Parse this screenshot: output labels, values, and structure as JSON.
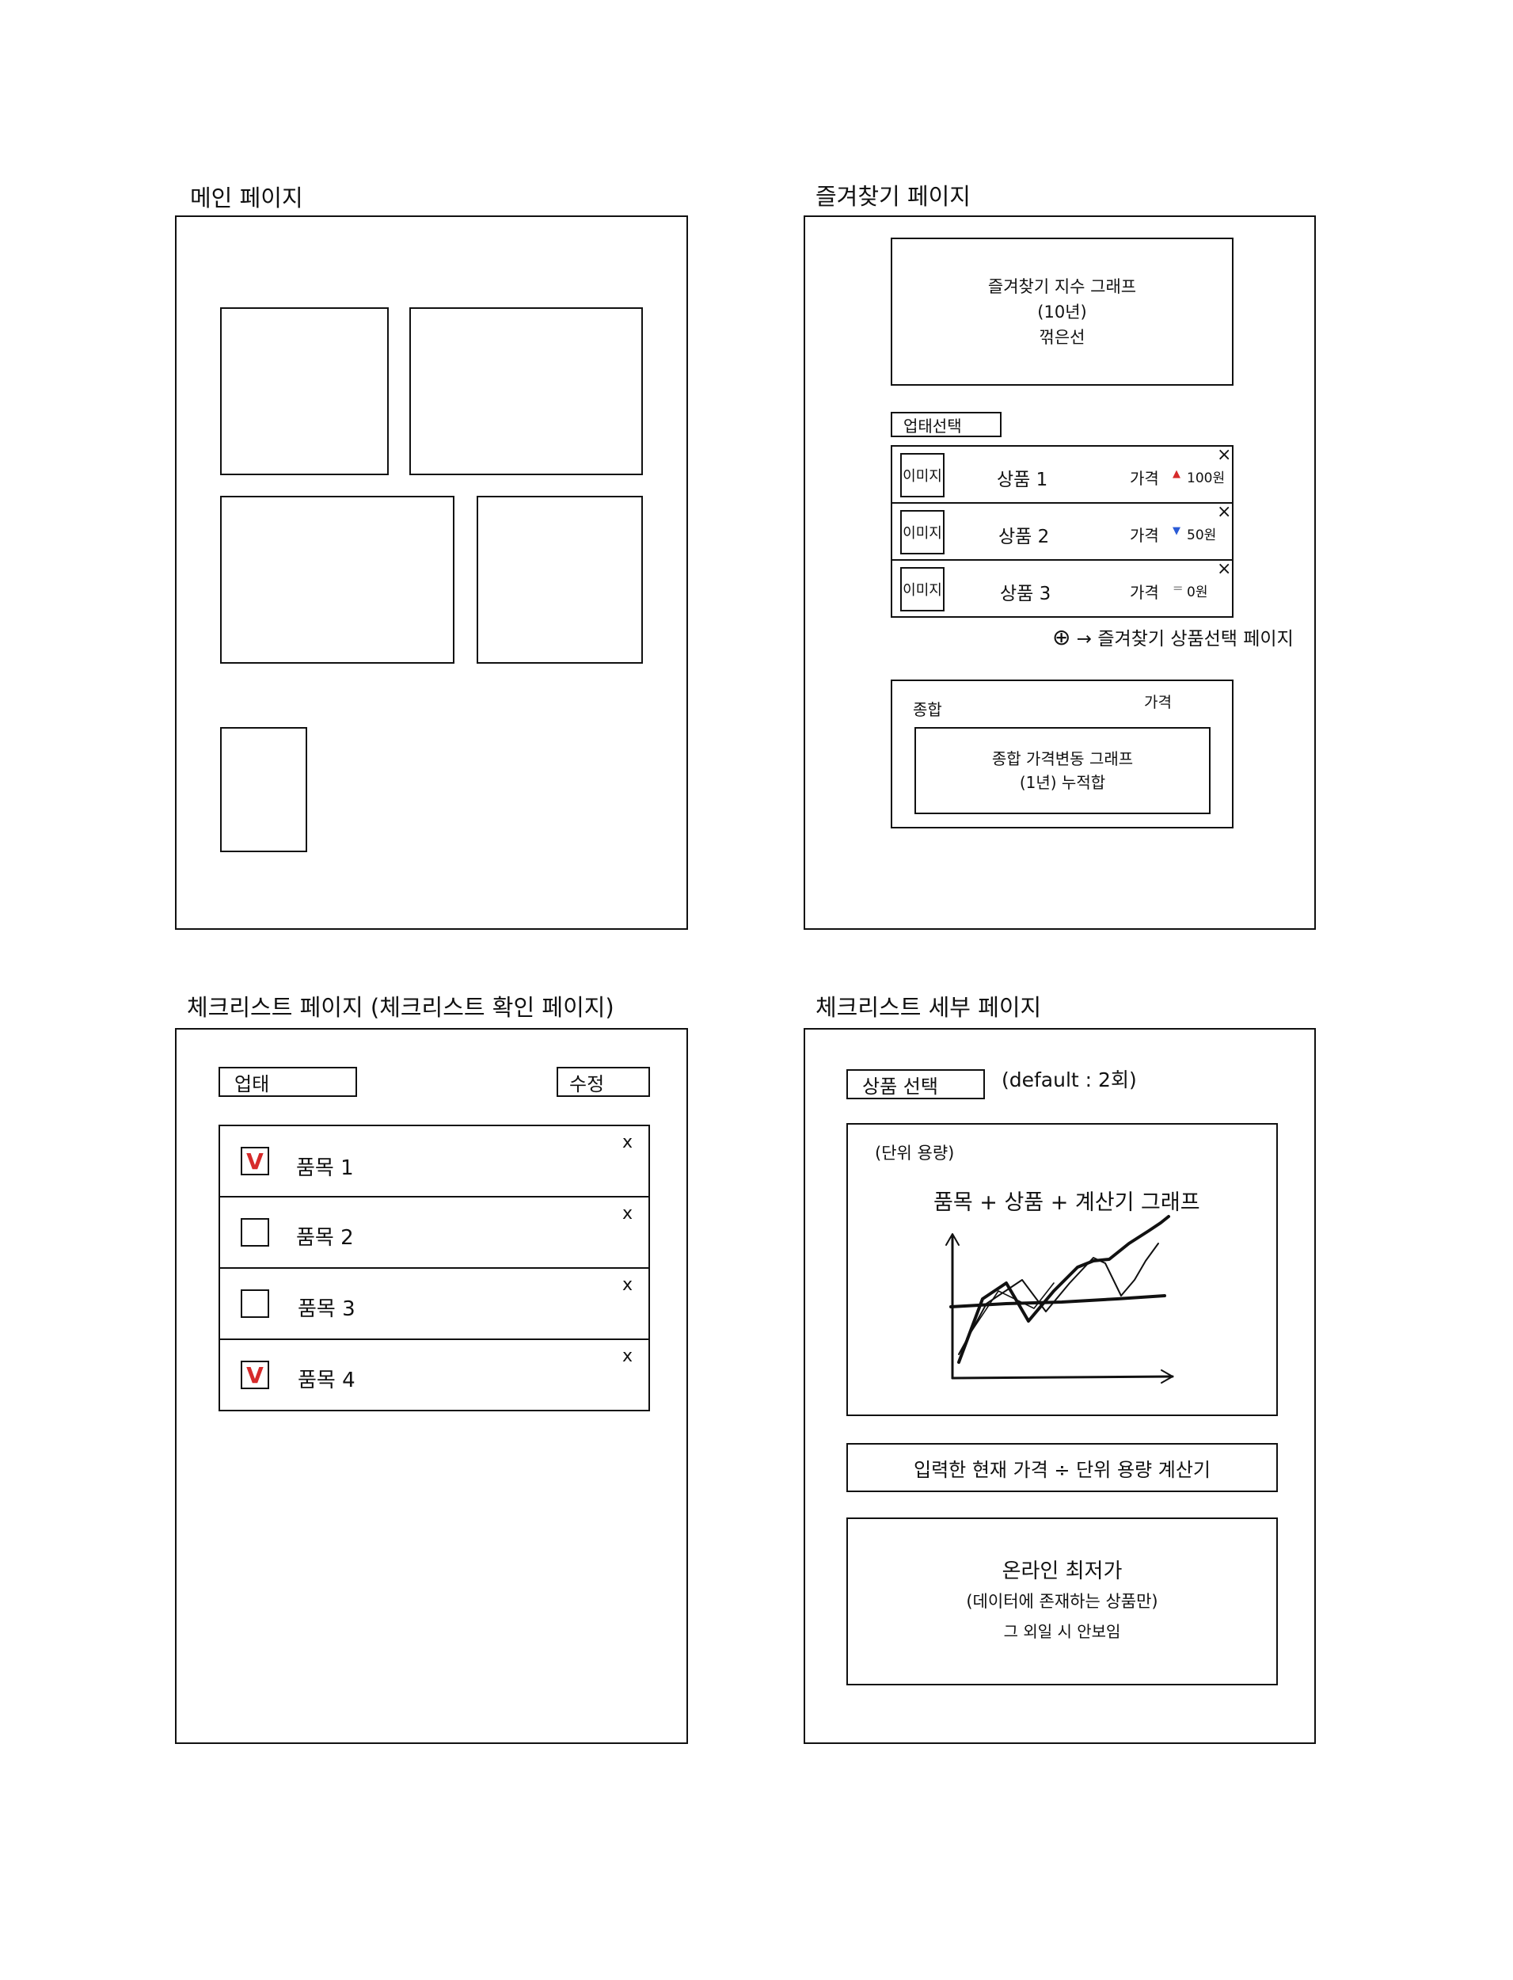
{
  "pages": {
    "main": {
      "title": "메인 페이지"
    },
    "favorites": {
      "title": "즐겨찾기 페이지",
      "index_graph": {
        "line1": "즐겨찾기 지수 그래프",
        "line2": "(10년)",
        "line3": "꺾은선"
      },
      "category_select": "업태선택",
      "items": [
        {
          "image": "이미지",
          "name": "상품 1",
          "price_label": "가격",
          "arrow": "▲",
          "change": "100원",
          "close": "×",
          "arrow_color": "#d62a2a"
        },
        {
          "image": "이미지",
          "name": "상품 2",
          "price_label": "가격",
          "arrow": "▼",
          "change": "50원",
          "close": "×",
          "arrow_color": "#2a5bd6"
        },
        {
          "image": "이미지",
          "name": "상품 3",
          "price_label": "가격",
          "arrow": "=",
          "change": "0원",
          "close": "×",
          "arrow_color": "#888888"
        }
      ],
      "add_note": {
        "icon": "⊕",
        "arrow": "→",
        "text": "즐겨찾기 상품선택 페이지"
      },
      "total": {
        "label": "종합",
        "price_label": "가격",
        "graph_line1": "종합 가격변동 그래프",
        "graph_line2": "(1년) 누적합"
      }
    },
    "checklist": {
      "title": "체크리스트 페이지 (체크리스트 확인 페이지)",
      "category": "업태",
      "edit": "수정",
      "items": [
        {
          "label": "품목 1",
          "checked": true,
          "mark": "V",
          "close": "x"
        },
        {
          "label": "품목 2",
          "checked": false,
          "mark": "",
          "close": "x"
        },
        {
          "label": "품목 3",
          "checked": false,
          "mark": "",
          "close": "x"
        },
        {
          "label": "품목 4",
          "checked": true,
          "mark": "V",
          "close": "x"
        }
      ]
    },
    "detail": {
      "title": "체크리스트 세부 페이지",
      "product_select": "상품 선택",
      "default_note": "(default : 2회)",
      "graph_unit": "(단위 용량)",
      "graph_title": "품목 + 상품 + 계산기 그래프",
      "calculator": "입력한 현재 가격 ÷ 단위 용량 계산기",
      "lowest": {
        "line1": "온라인 최저가",
        "line2": "(데이터에 존재하는 상품만)",
        "line3": "그 외일 시 안보임"
      }
    }
  }
}
